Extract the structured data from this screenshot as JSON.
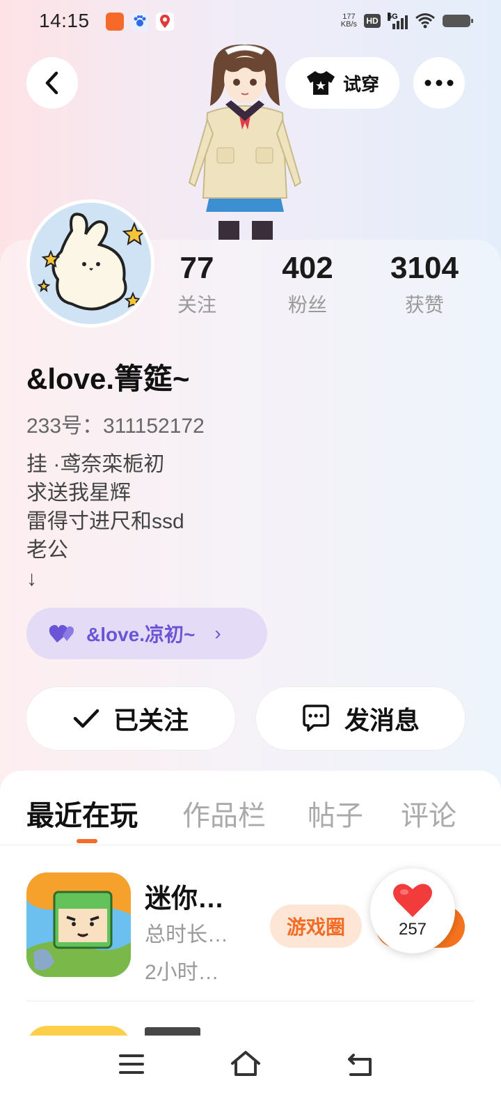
{
  "status_bar": {
    "time": "14:15",
    "net_speed_value": "177",
    "net_speed_unit": "KB/s",
    "hd": "HD",
    "network": "5G"
  },
  "header": {
    "tryon_label": "试穿"
  },
  "profile": {
    "stats": [
      {
        "value": "77",
        "label": "关注"
      },
      {
        "value": "402",
        "label": "粉丝"
      },
      {
        "value": "3104",
        "label": "获赞"
      }
    ],
    "name": "&love.箐筵~",
    "id_line": "233号：311152172",
    "bio": [
      "挂 ·鸢奈栾栀初",
      "求送我星辉",
      "雷得寸进尺和ssd",
      "老公",
      "↓"
    ],
    "cp_link": "&love.凉初~",
    "follow_label": "已关注",
    "message_label": "发消息"
  },
  "tabs": [
    "最近在玩",
    "作品栏",
    "帖子",
    "评论"
  ],
  "games": [
    {
      "title": "迷你…",
      "line1": "总时长…",
      "line2": "2小时…",
      "circle_label": "游戏圈"
    }
  ],
  "like_bubble": {
    "count": "257"
  },
  "colors": {
    "accent": "#f36d2a",
    "cp_purple": "#6a55d6",
    "cp_bg": "#e4dcf6",
    "like_red": "#f23b3b"
  }
}
